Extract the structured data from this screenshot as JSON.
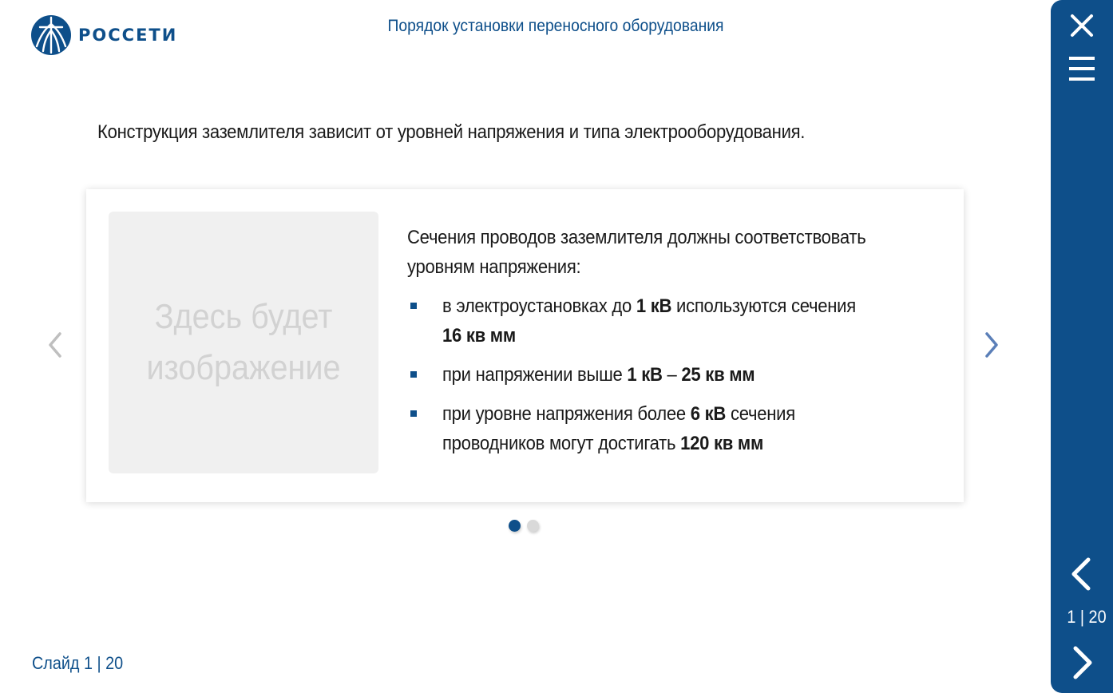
{
  "brand": {
    "name": "РОССЕТИ",
    "color": "#0e4f8a"
  },
  "header": {
    "title": "Порядок установки переносного оборудования"
  },
  "intro": "Конструкция заземлителя зависит от уровней напряжения и типа электрооборудования.",
  "card": {
    "image_placeholder": "Здесь будет изображение",
    "lead": "Сечения проводов заземлителя должны соответствовать уровням напряжения:",
    "bullets": [
      {
        "t1": "в электроустановках до ",
        "b1": "1 кВ",
        "t2": " используются сечения ",
        "b2": "16 кв мм",
        "t3": ""
      },
      {
        "t1": "при напряжении выше ",
        "b1": "1 кВ",
        "t2": " – ",
        "b2": "25 кв мм",
        "t3": ""
      },
      {
        "t1": "при уровне напряжения более ",
        "b1": "6 кВ",
        "t2": " сечения проводников могут достигать ",
        "b2": "120 кв мм",
        "t3": ""
      }
    ]
  },
  "carousel": {
    "current_index": 1,
    "total": 2,
    "icons": [
      "chevron-left-icon",
      "chevron-right-icon"
    ]
  },
  "footer": {
    "slide_label": "Слайд 1 | 20"
  },
  "sidebar": {
    "counter": "1 | 20",
    "icons": [
      "close-icon",
      "menu-icon",
      "chevron-left-icon",
      "chevron-right-icon"
    ]
  }
}
